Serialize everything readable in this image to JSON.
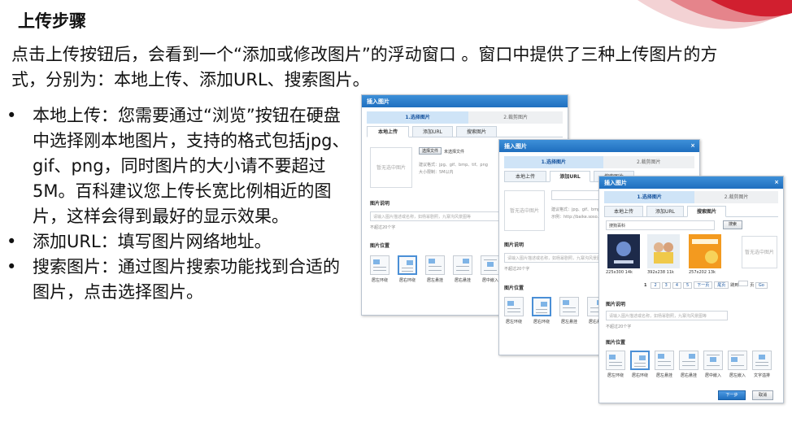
{
  "slide": {
    "title": "上传步骤",
    "intro": "点击上传按钮后，会看到一个“添加或修改图片”的浮动窗口 。窗口中提供了三种上传图片的方式，分别为：本地上传、添加URL、搜索图片。",
    "bullets": [
      "本地上传：您需要通过“浏览”按钮在硬盘中选择刚本地图片，支持的格式包括jpg、gif、png，同时图片的大小请不要超过5M。百科建议您上传长宽比例相近的图片，这样会得到最好的显示效果。",
      "添加URL：填写图片网络地址。",
      "搜索图片：通过图片搜索功能找到合适的图片，点击选择图片。"
    ]
  },
  "dialog": {
    "title": "插入图片",
    "close_glyph": "×",
    "step1": "1.选择图片",
    "step2": "2.裁剪图片",
    "tabs": [
      "本地上传",
      "添加URL",
      "搜索图片"
    ],
    "placeholder": "暂无选中图片",
    "local": {
      "choose_button": "选择文件",
      "no_file": "未选择文件",
      "format_hint": "建议格式：jpg、gif、bmp、tif、png",
      "size_hint": "大小限制：5M以内"
    },
    "url": {
      "format_hint": "建议格式：jpg、gif、bmp、tif、png",
      "example": "示例：http://baike.soso..."
    },
    "desc_label": "图片说明",
    "desc_placeholder": "请输入图片描述或名称，如杨幂剧照，九寨沟风景图等",
    "desc_limit": "不超过20个字",
    "position_label": "图片位置",
    "positions": [
      "居左环绕",
      "居右环绕",
      "居左悬挂",
      "居右悬挂",
      "居中嵌入",
      "居左嵌入",
      "文字溢排"
    ],
    "search": {
      "query": "搜狗百科",
      "button": "搜索",
      "results": [
        "225x300 14k",
        "392x238 11k",
        "257x202 13k"
      ],
      "pages": [
        "1",
        "2",
        "3",
        "4",
        "5",
        "下一页",
        "尾页"
      ],
      "goto": "跳到",
      "page_unit": "页",
      "go": "Go"
    },
    "next_button": "下一步",
    "cancel_button": "取消"
  },
  "colors": {
    "header_blue": "#1f6fbf",
    "swoosh_red": "#d11f2f"
  }
}
